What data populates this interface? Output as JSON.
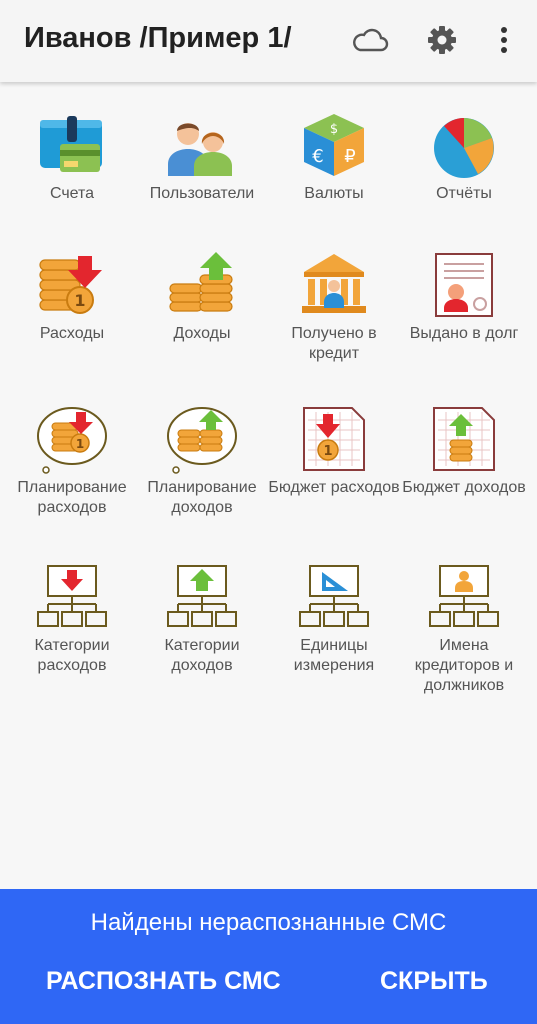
{
  "appbar": {
    "title": "Иванов /Пример 1/",
    "icons": [
      "cloud-icon",
      "gear-icon",
      "more-vert-icon"
    ]
  },
  "tiles": [
    {
      "label": "Счета",
      "icon": "accounts-wallet-icon"
    },
    {
      "label": "Пользователи",
      "icon": "users-icon"
    },
    {
      "label": "Валюты",
      "icon": "currency-cube-icon"
    },
    {
      "label": "Отчёты",
      "icon": "pie-chart-icon"
    },
    {
      "label": "Расходы",
      "icon": "coins-down-icon"
    },
    {
      "label": "Доходы",
      "icon": "coins-up-icon"
    },
    {
      "label": "Получено в кредит",
      "icon": "bank-icon"
    },
    {
      "label": "Выдано в долг",
      "icon": "loan-document-icon"
    },
    {
      "label": "Планирование расходов",
      "icon": "planning-expenses-icon"
    },
    {
      "label": "Планирование доходов",
      "icon": "planning-income-icon"
    },
    {
      "label": "Бюджет расходов",
      "icon": "budget-expenses-icon"
    },
    {
      "label": "Бюджет доходов",
      "icon": "budget-income-icon"
    },
    {
      "label": "Категории расходов",
      "icon": "expense-categories-icon"
    },
    {
      "label": "Категории доходов",
      "icon": "income-categories-icon"
    },
    {
      "label": "Единицы измерения",
      "icon": "units-icon"
    },
    {
      "label": "Имена кредиторов и должников",
      "icon": "creditors-names-icon"
    }
  ],
  "snackbar": {
    "message": "Найдены нераспознанные СМС",
    "recognize_label": "РАСПОЗНАТЬ СМС",
    "hide_label": "СКРЫТЬ"
  },
  "colors": {
    "accent": "#2f67f5",
    "coin": "#f2a53a",
    "down_arrow": "#e3262e",
    "up_arrow": "#6bbf3b"
  }
}
